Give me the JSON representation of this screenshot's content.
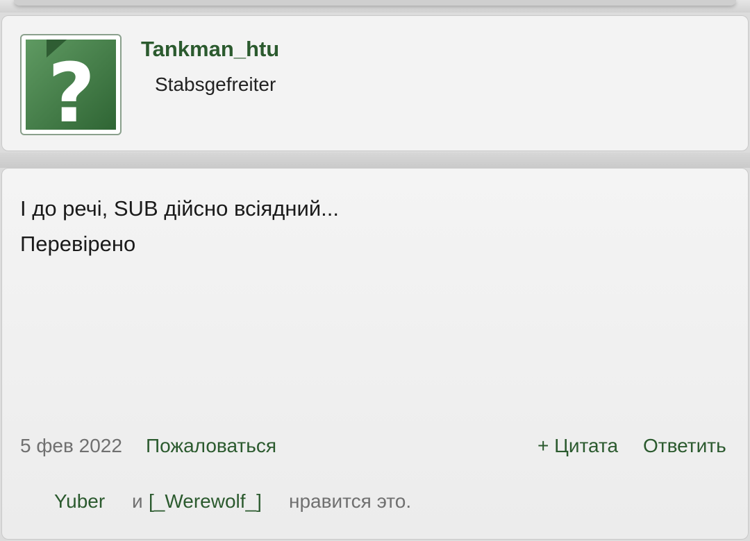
{
  "user": {
    "username": "Tankman_htu",
    "rank": "Stabsgefreiter",
    "avatar_icon": "question-mark-icon",
    "avatar_colors": {
      "bg": "#3f7a45",
      "fold": "#2f5d33",
      "mark": "#ffffff"
    }
  },
  "post": {
    "lines": [
      "І до речі, SUB дійсно всіядний...",
      "Перевірено"
    ],
    "date": "5 фев 2022",
    "report_label": "Пожаловаться",
    "quote_label": "+ Цитата",
    "reply_label": "Ответить"
  },
  "likes": {
    "user1": "Yuber",
    "and": "и",
    "user2": "[_Werewolf_]",
    "suffix": "нравится это."
  },
  "colors": {
    "link": "#2b5a2e",
    "muted": "#707070",
    "card_bg": "#f3f3f3"
  }
}
